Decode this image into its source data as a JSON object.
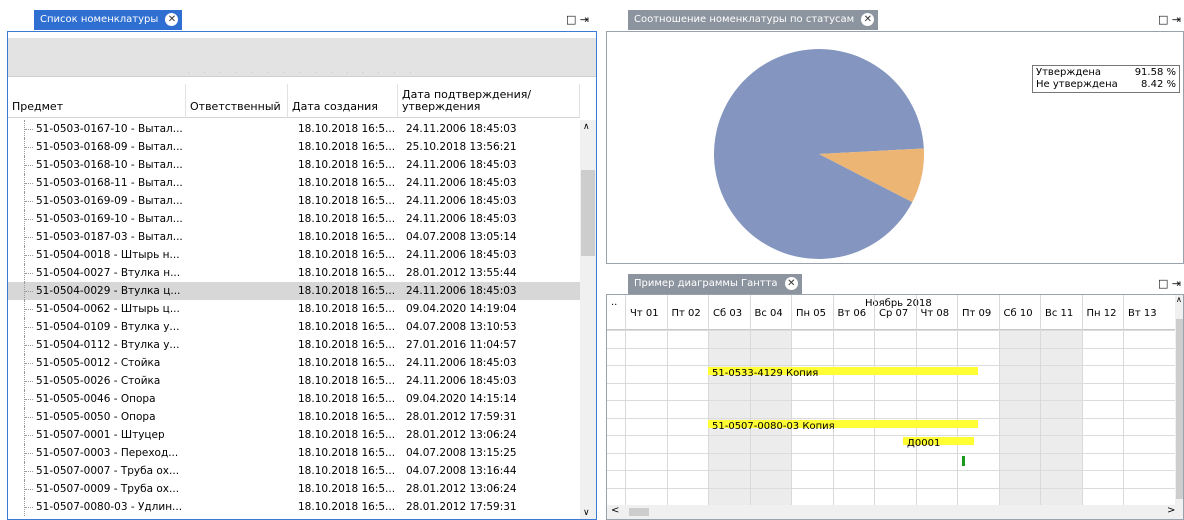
{
  "left_tab": {
    "title": "Список номенклатуры",
    "pin": "□ ⇥"
  },
  "table": {
    "columns": [
      "Предмет",
      "Ответственный",
      "Дата создания",
      "Дата подтверждения/утверждения"
    ],
    "rows": [
      {
        "item": "51-0503-0167-10 - Вытал...",
        "owner": "",
        "created": "18.10.2018 16:5...",
        "approved": "24.11.2006 18:45:03"
      },
      {
        "item": "51-0503-0168-09 - Вытал...",
        "owner": "",
        "created": "18.10.2018 16:5...",
        "approved": "25.10.2018 13:56:21"
      },
      {
        "item": "51-0503-0168-10 - Вытал...",
        "owner": "",
        "created": "18.10.2018 16:5...",
        "approved": "24.11.2006 18:45:03"
      },
      {
        "item": "51-0503-0168-11 - Вытал...",
        "owner": "",
        "created": "18.10.2018 16:5...",
        "approved": "24.11.2006 18:45:03"
      },
      {
        "item": "51-0503-0169-09 - Вытал...",
        "owner": "",
        "created": "18.10.2018 16:5...",
        "approved": "24.11.2006 18:45:03"
      },
      {
        "item": "51-0503-0169-10 - Вытал...",
        "owner": "",
        "created": "18.10.2018 16:5...",
        "approved": "24.11.2006 18:45:03"
      },
      {
        "item": "51-0503-0187-03 - Вытал...",
        "owner": "",
        "created": "18.10.2018 16:5...",
        "approved": "04.07.2008 13:05:14"
      },
      {
        "item": "51-0504-0018 - Штырь н...",
        "owner": "",
        "created": "18.10.2018 16:5...",
        "approved": "24.11.2006 18:45:03"
      },
      {
        "item": "51-0504-0027 - Втулка н...",
        "owner": "",
        "created": "18.10.2018 16:5...",
        "approved": "28.01.2012 13:55:44"
      },
      {
        "item": "51-0504-0029 - Втулка ц...",
        "owner": "",
        "created": "18.10.2018 16:5...",
        "approved": "24.11.2006 18:45:03"
      },
      {
        "item": "51-0504-0062 - Штырь ц...",
        "owner": "",
        "created": "18.10.2018 16:5...",
        "approved": "09.04.2020 14:19:04"
      },
      {
        "item": "51-0504-0109 - Втулка у...",
        "owner": "",
        "created": "18.10.2018 16:5...",
        "approved": "04.07.2008 13:10:53"
      },
      {
        "item": "51-0504-0112 - Втулка у...",
        "owner": "",
        "created": "18.10.2018 16:5...",
        "approved": "27.01.2016 11:04:57"
      },
      {
        "item": "51-0505-0012 - Стойка",
        "owner": "",
        "created": "18.10.2018 16:5...",
        "approved": "24.11.2006 18:45:03"
      },
      {
        "item": "51-0505-0026 - Стойка",
        "owner": "",
        "created": "18.10.2018 16:5...",
        "approved": "24.11.2006 18:45:03"
      },
      {
        "item": "51-0505-0046 - Опора",
        "owner": "",
        "created": "18.10.2018 16:5...",
        "approved": "09.04.2020 14:15:14"
      },
      {
        "item": "51-0505-0050 - Опора",
        "owner": "",
        "created": "18.10.2018 16:5...",
        "approved": "28.01.2012 17:59:31"
      },
      {
        "item": "51-0507-0001 - Штуцер",
        "owner": "",
        "created": "18.10.2018 16:5...",
        "approved": "28.01.2012 13:06:24"
      },
      {
        "item": "51-0507-0003 - Переход...",
        "owner": "",
        "created": "18.10.2018 16:5...",
        "approved": "04.07.2008 13:15:25"
      },
      {
        "item": "51-0507-0007 - Труба ох...",
        "owner": "",
        "created": "18.10.2018 16:5...",
        "approved": "04.07.2008 13:16:44"
      },
      {
        "item": "51-0507-0009 - Труба ох...",
        "owner": "",
        "created": "18.10.2018 16:5...",
        "approved": "28.01.2012 13:06:24"
      },
      {
        "item": "51-0507-0080-03 - Удлин...",
        "owner": "",
        "created": "18.10.2018 16:5...",
        "approved": "28.01.2012 17:59:31"
      }
    ],
    "selected_row": 9
  },
  "pie_tab": {
    "title": "Соотношение номенклатуры по статусам",
    "pin": "□ ⇥"
  },
  "pie": {
    "legend": [
      {
        "label": "Утверждена",
        "value": "91.58 %"
      },
      {
        "label": "Не утверждена",
        "value": "8.42 %"
      }
    ],
    "colors": {
      "approved": "#8496bf",
      "not_approved": "#ecb574"
    }
  },
  "chart_data": {
    "type": "pie",
    "categories": [
      "Утверждена",
      "Не утверждена"
    ],
    "values": [
      91.58,
      8.42
    ]
  },
  "gantt_tab": {
    "title": "Пример диаграммы Гантта",
    "pin": "□ ⇥"
  },
  "gantt": {
    "corner": "..",
    "month": "Ноябрь 2018",
    "days": [
      "Чт 01",
      "Пт 02",
      "Сб 03",
      "Вс 04",
      "Пн 05",
      "Вт 06",
      "Ср 07",
      "Чт 08",
      "Пт 09",
      "Сб 10",
      "Вс 11",
      "Пн 12",
      "Вт 13"
    ],
    "weekend_index": [
      2,
      3,
      9,
      10
    ],
    "tasks": [
      {
        "label": "51-0533-4129 Копия",
        "start": 2,
        "end": 8.5,
        "row": 2
      },
      {
        "label": "51-0507-0080-03 Копия",
        "start": 2,
        "end": 8.5,
        "row": 5
      },
      {
        "label": "Д0001",
        "start": 6.7,
        "end": 8.4,
        "row": 6
      }
    ],
    "colors": {
      "bar": "#ffff33",
      "weekend": "#ececec",
      "marker": "#1a9a1a"
    }
  }
}
